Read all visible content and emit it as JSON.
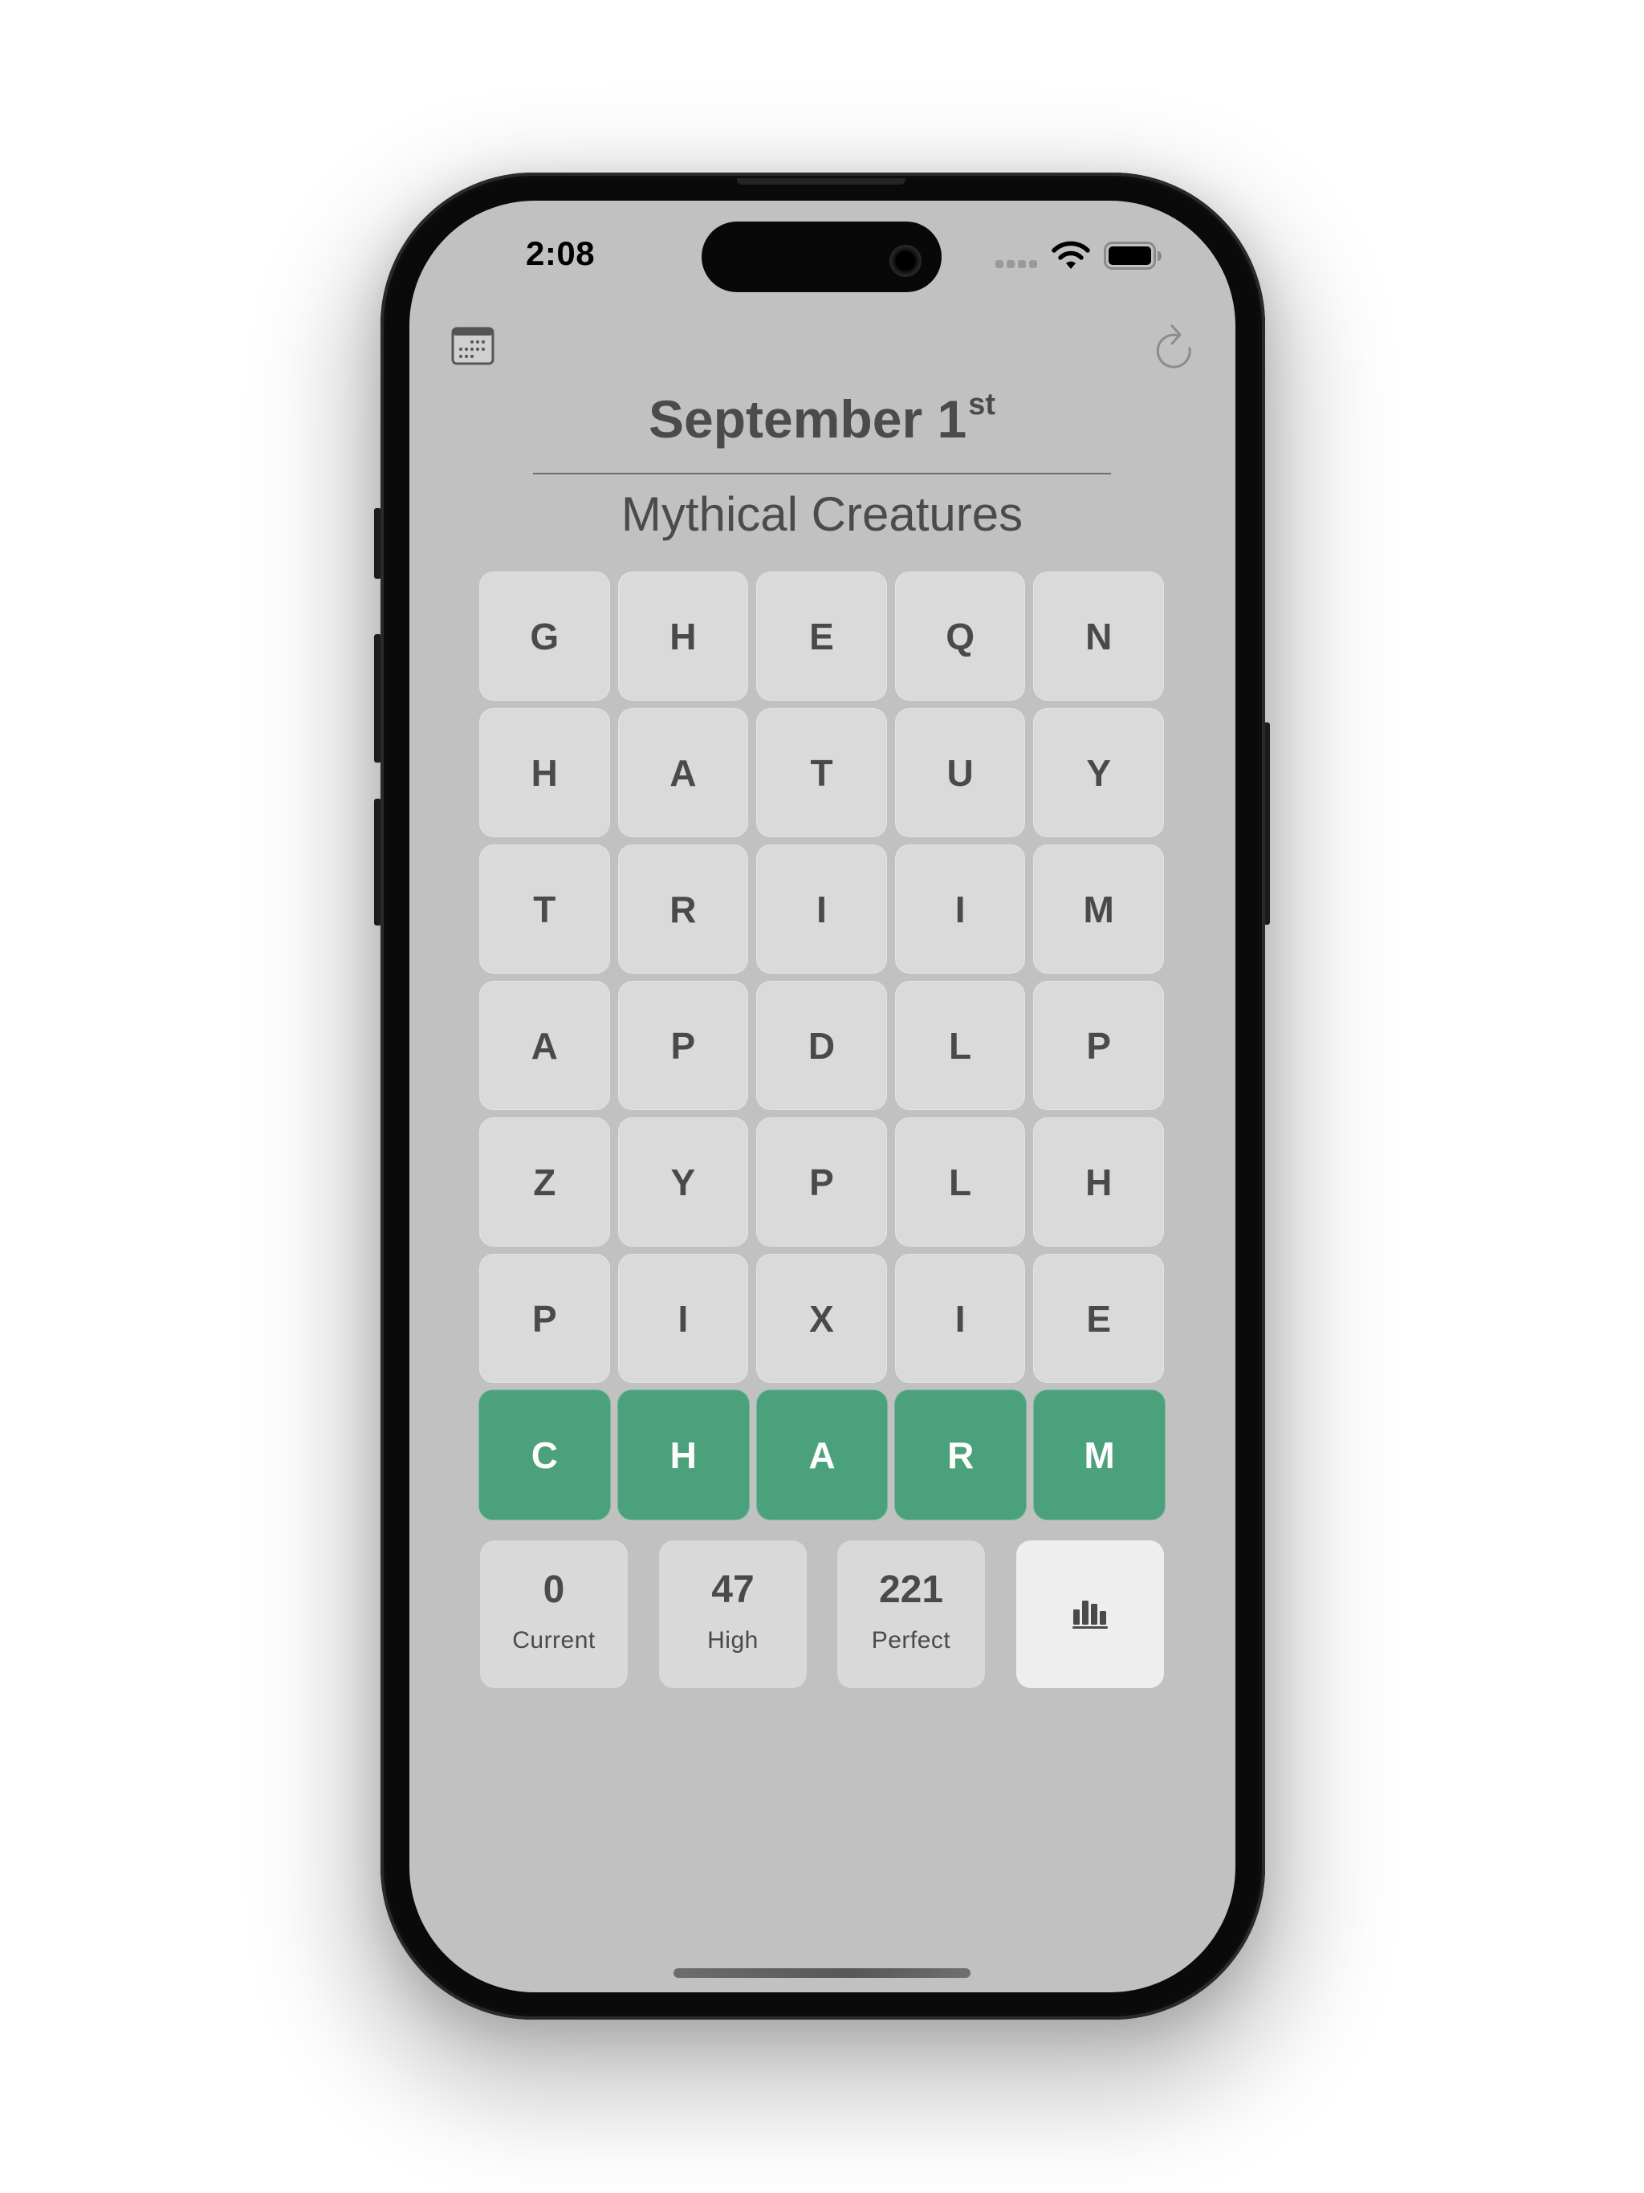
{
  "status_bar": {
    "time": "2:08",
    "signal_icon": "cellular-signal-icon",
    "wifi_icon": "wifi-icon",
    "battery_icon": "battery-full-icon"
  },
  "toolbar": {
    "left_icon": "calendar-icon",
    "right_icon": "refresh-icon"
  },
  "header": {
    "date_main": "September 1",
    "date_suffix": "st",
    "category": "Mythical Creatures"
  },
  "grid": {
    "rows": [
      [
        "G",
        "H",
        "E",
        "Q",
        "N"
      ],
      [
        "H",
        "A",
        "T",
        "U",
        "Y"
      ],
      [
        "T",
        "R",
        "I",
        "I",
        "M"
      ],
      [
        "A",
        "P",
        "D",
        "L",
        "P"
      ],
      [
        "Z",
        "Y",
        "P",
        "L",
        "H"
      ],
      [
        "P",
        "I",
        "X",
        "I",
        "E"
      ]
    ]
  },
  "answer": {
    "letters": [
      "C",
      "H",
      "A",
      "R",
      "M"
    ],
    "color": "#4ba17b"
  },
  "stats": {
    "items": [
      {
        "value": "0",
        "label": "Current"
      },
      {
        "value": "47",
        "label": "High"
      },
      {
        "value": "221",
        "label": "Perfect"
      }
    ],
    "chart_button_icon": "bar-chart-icon"
  },
  "colors": {
    "screen_bg": "#c1c1c1",
    "tile_bg": "#dadada",
    "text": "#4a4a4a",
    "stats_button_bg": "#eeeeee"
  }
}
